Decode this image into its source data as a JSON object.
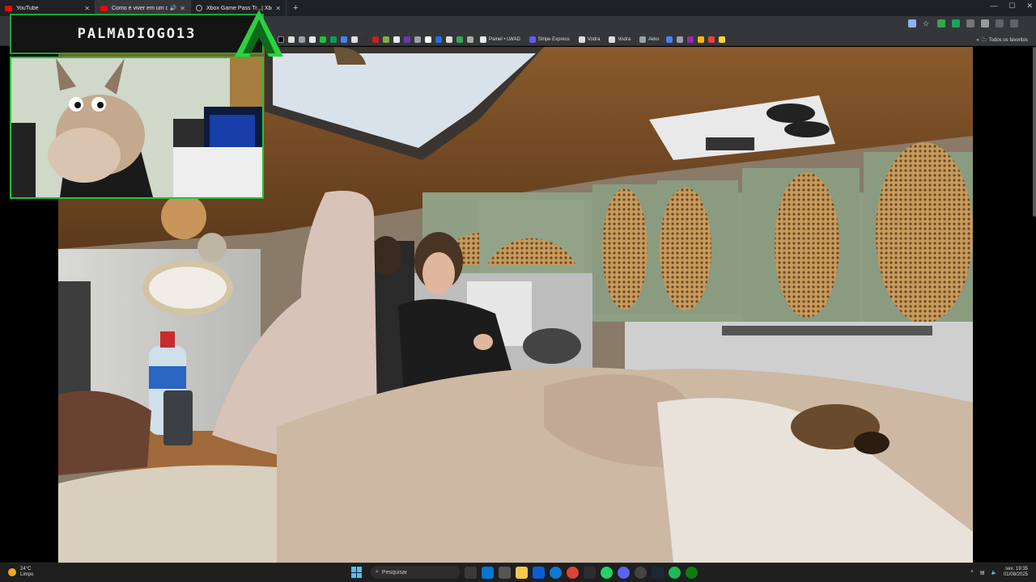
{
  "browser": {
    "tabs": [
      {
        "title": "YouTube",
        "favicon": "youtube-icon",
        "active": false
      },
      {
        "title": "Como é viver em um carro",
        "favicon": "youtube-icon",
        "active": true,
        "audio": true
      },
      {
        "title": "Xbox Game Pass Tr...| Xbox",
        "favicon": "globe-icon",
        "active": false
      }
    ],
    "new_tab": "+",
    "bookmarks": [
      {
        "label": "Painel • LWAD"
      },
      {
        "label": "Stripe Express"
      },
      {
        "label": "Vodra"
      },
      {
        "label": "Vodra"
      },
      {
        "label": "Akko"
      }
    ],
    "bookmarks_folder": "Todos os favoritos"
  },
  "overlay": {
    "streamer_name": "PALMADIOGO13",
    "accent": "#22c33a"
  },
  "taskbar": {
    "weather_temp": "24°C",
    "weather_desc": "Limpo",
    "search_placeholder": "Pesquisar",
    "time": "19:35",
    "date_line1": "sex.",
    "date_line2": "01/08/2025"
  }
}
